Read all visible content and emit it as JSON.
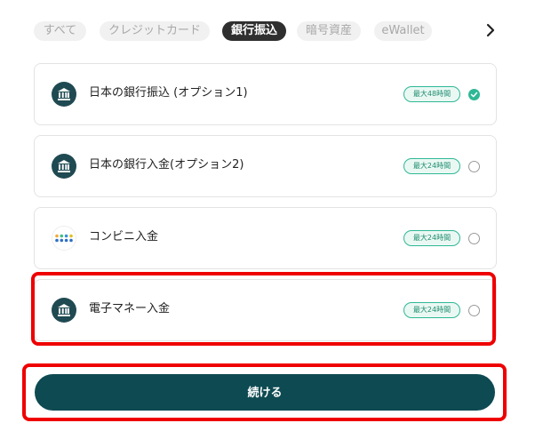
{
  "tabs": [
    {
      "label": "すべて",
      "active": false
    },
    {
      "label": "クレジットカード",
      "active": false
    },
    {
      "label": "銀行振込",
      "active": true
    },
    {
      "label": "暗号資産",
      "active": false
    },
    {
      "label": "eWallet",
      "active": false
    }
  ],
  "next_icon": "chevron-right-icon",
  "methods": [
    {
      "label": "日本の銀行振込 (オプション1)",
      "badge": "最大48時間",
      "icon": "bank-icon",
      "selected": true
    },
    {
      "label": "日本の銀行入金(オプション2)",
      "badge": "最大24時間",
      "icon": "bank-icon",
      "selected": false
    },
    {
      "label": "コンビニ入金",
      "badge": "最大24時間",
      "icon": "convenience-store-dots-icon",
      "selected": false
    },
    {
      "label": "電子マネー入金",
      "badge": "最大24時間",
      "icon": "bank-icon",
      "selected": false
    }
  ],
  "continue_label": "続ける",
  "colors": {
    "primary": "#0e4a52",
    "accent_green": "#2fb895",
    "highlight_red": "#ef0000",
    "active_tab": "#2f2f2f"
  }
}
